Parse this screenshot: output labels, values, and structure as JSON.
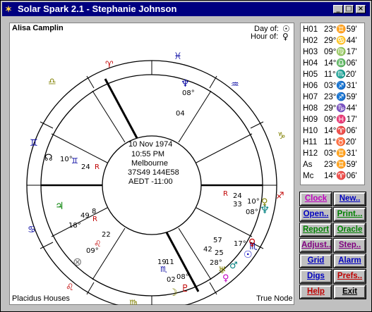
{
  "window": {
    "title": "Solar Spark 2.1 - Stephanie Johnson"
  },
  "chart": {
    "person_name": "Alisa Camplin",
    "day_of_label": "Day of:",
    "hour_of_label": "Hour of:",
    "house_system": "Placidus Houses",
    "node_type": "True Node",
    "center": {
      "date": "10 Nov 1974",
      "time": "10:55 PM",
      "place": "Melbourne",
      "coords": "37S49 144E58",
      "timezone": "AEDT -11:00"
    },
    "planet_labels": {
      "moon_deg": "10°",
      "moon_min": "24",
      "rahu_24": "24",
      "rahu_r": "R",
      "jup_18": "18°",
      "jup_49": "49",
      "jup_8": "8",
      "saturn_r": "R",
      "chiron_22": "22",
      "chiron_9": "09°",
      "merc_bot_19": "19",
      "merc_bot_11": "11",
      "merc_bot_02": "02",
      "merc_bot_08": "08°",
      "pluto_10": "10°",
      "pluto_08": "08°",
      "pluto_24": "24",
      "pluto_33": "33",
      "pluto_r": "R",
      "venus_42": "42",
      "venus_57": "57",
      "venus_17": "17°",
      "venus_25": "25",
      "venus_28": "28°",
      "nep_08": "08°",
      "nep_04": "04"
    }
  },
  "houses": [
    {
      "label": "H01",
      "value": "23°♊59'"
    },
    {
      "label": "H02",
      "value": "29°♋44'"
    },
    {
      "label": "H03",
      "value": "09°♍17'"
    },
    {
      "label": "H04",
      "value": "14°♎06'"
    },
    {
      "label": "H05",
      "value": "11°♏20'"
    },
    {
      "label": "H06",
      "value": "03°♐31'"
    },
    {
      "label": "H07",
      "value": "23°♐59'"
    },
    {
      "label": "H08",
      "value": "29°♑44'"
    },
    {
      "label": "H09",
      "value": "09°♓17'"
    },
    {
      "label": "H10",
      "value": "14°♈06'"
    },
    {
      "label": "H11",
      "value": "11°♉20'"
    },
    {
      "label": "H12",
      "value": "03°♊31'"
    },
    {
      "label": "As",
      "value": "23°♊59'"
    },
    {
      "label": "Mc",
      "value": "14°♈06'"
    }
  ],
  "buttons": [
    {
      "id": "clock",
      "label": "Clock",
      "color": "#c000c0"
    },
    {
      "id": "new",
      "label": "New..",
      "color": "#0000c0"
    },
    {
      "id": "open",
      "label": "Open..",
      "color": "#0000c0"
    },
    {
      "id": "print",
      "label": "Print...",
      "color": "#008000"
    },
    {
      "id": "report",
      "label": "Report",
      "color": "#008000"
    },
    {
      "id": "oracle",
      "label": "Oracle",
      "color": "#008000"
    },
    {
      "id": "adjust",
      "label": "Adjust..",
      "color": "#800080"
    },
    {
      "id": "step",
      "label": "Step..",
      "color": "#800080"
    },
    {
      "id": "grid",
      "label": "Grid",
      "color": "#0000c0"
    },
    {
      "id": "alarm",
      "label": "Alarm",
      "color": "#0000c0"
    },
    {
      "id": "digs",
      "label": "Digs",
      "color": "#0000c0"
    },
    {
      "id": "prefs",
      "label": "Prefs..",
      "color": "#c00000"
    },
    {
      "id": "help",
      "label": "Help",
      "color": "#c00000"
    },
    {
      "id": "exit",
      "label": "Exit",
      "color": "#000000"
    }
  ],
  "icons": {
    "sun": "sun-icon",
    "venus": "venus-icon"
  }
}
